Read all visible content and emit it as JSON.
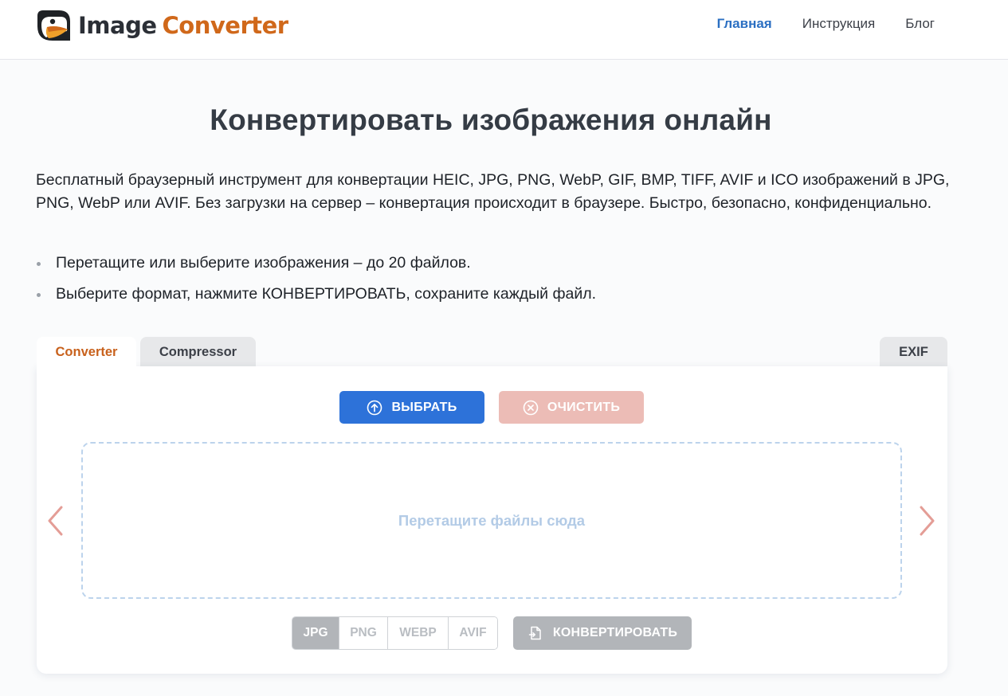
{
  "header": {
    "logo_word_1": "Image",
    "logo_word_2": "Converter",
    "logo_icon": "toucan-logo-icon",
    "nav": [
      {
        "label": "Главная",
        "active": true
      },
      {
        "label": "Инструкция",
        "active": false
      },
      {
        "label": "Блог",
        "active": false
      }
    ]
  },
  "hero": {
    "title": "Конвертировать изображения онлайн",
    "description": "Бесплатный браузерный инструмент для конвертации HEIC, JPG, PNG, WebP, GIF, BMP, TIFF, AVIF и ICO изображений в JPG, PNG, WebP или AVIF. Без загрузки на сервер – конвертация происходит в браузере. Быстро, безопасно, конфиденциально.",
    "bullets": [
      "Перетащите или выберите изображения – до 20 файлов.",
      "Выберите формат, нажмите КОНВЕРТИРОВАТЬ, сохраните каждый файл."
    ]
  },
  "tabs": {
    "converter": "Converter",
    "compressor": "Compressor",
    "exif": "EXIF",
    "active": "converter"
  },
  "tool": {
    "select_label": "ВЫБРАТЬ",
    "clear_label": "ОЧИСТИТЬ",
    "dropzone_text": "Перетащите файлы сюда",
    "formats": [
      "JPG",
      "PNG",
      "WEBP",
      "AVIF"
    ],
    "selected_format": "JPG",
    "convert_label": "КОНВЕРТИРОВАТЬ",
    "icons": {
      "select": "upload-arrow-circle-icon",
      "clear": "close-circle-icon",
      "convert": "file-convert-icon",
      "prev": "chevron-left-icon",
      "next": "chevron-right-icon"
    }
  },
  "colors": {
    "brand_orange": "#d0681a",
    "primary_blue": "#2d72d9",
    "clear_disabled": "#ecbcb6",
    "dropzone_border": "#bcd3ec",
    "disabled_gray": "#b2b5b9",
    "arrow_color": "#e49d96"
  }
}
